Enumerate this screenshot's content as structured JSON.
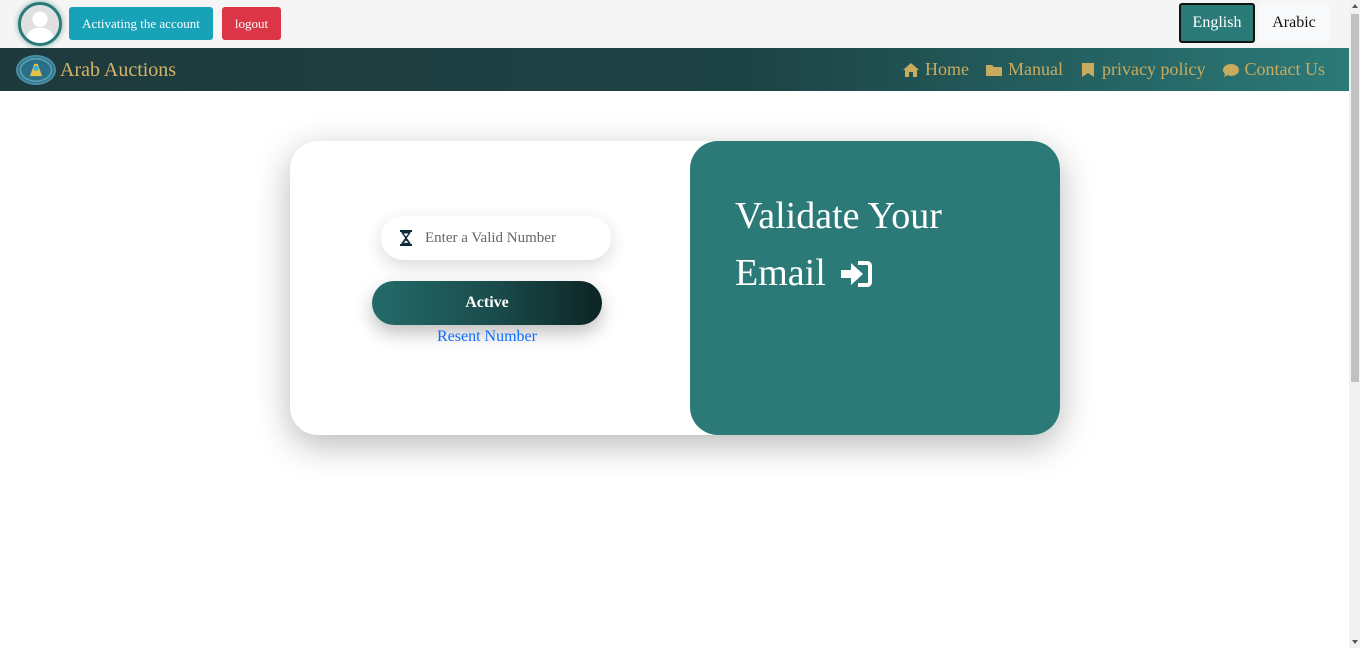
{
  "topbar": {
    "activate_label": "Activating the account",
    "logout_label": "logout",
    "lang_english": "English",
    "lang_arabic": "Arabic"
  },
  "navbar": {
    "brand": "Arab Auctions",
    "links": [
      {
        "label": "Home",
        "icon": "home-icon"
      },
      {
        "label": "Manual",
        "icon": "folder-icon"
      },
      {
        "label": "privacy policy",
        "icon": "bookmark-icon"
      },
      {
        "label": "Contact Us",
        "icon": "comment-icon"
      }
    ]
  },
  "form": {
    "number_placeholder": "Enter a Valid Number",
    "number_value": "",
    "active_label": "Active",
    "resend_label": "Resent Number"
  },
  "panel": {
    "title": "Validate Your Email"
  },
  "colors": {
    "primary_teal": "#2b7a78",
    "gold": "#c9ab5e",
    "info": "#17a2b8",
    "danger": "#dc3545",
    "link": "#0d6efd"
  }
}
